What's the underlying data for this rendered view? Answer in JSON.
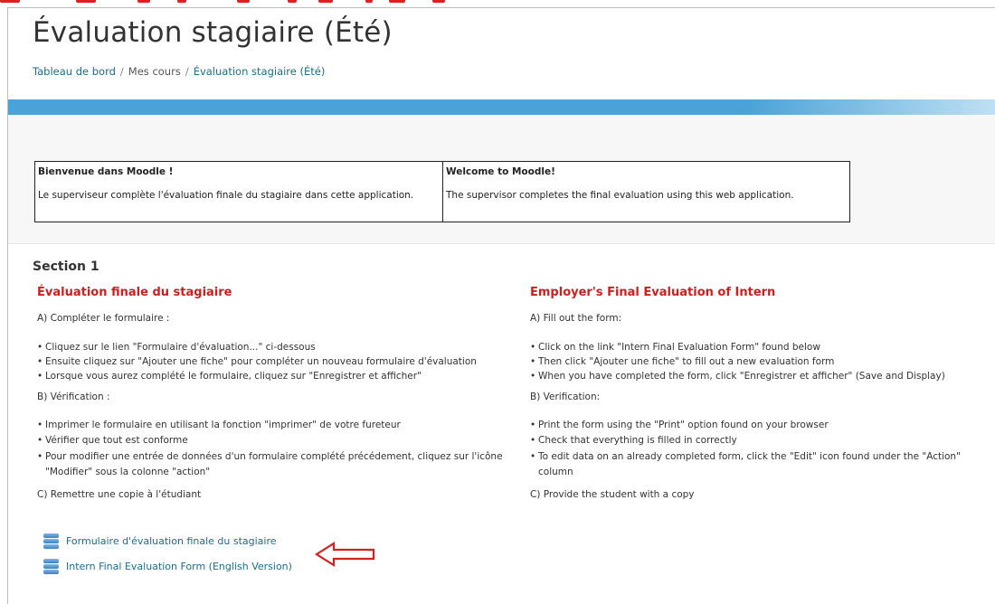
{
  "page": {
    "title": "Évaluation stagiaire (Été)"
  },
  "breadcrumb": {
    "items": [
      "Tableau de bord",
      "Mes cours",
      "Évaluation stagiaire (Été)"
    ],
    "separator": "/"
  },
  "welcome": {
    "fr_heading": "Bienvenue dans Moodle !",
    "fr_text": "Le superviseur complète l'évaluation finale du stagiaire dans cette application.",
    "en_heading": "Welcome to Moodle!",
    "en_text": "The supervisor completes the final evaluation using this web application."
  },
  "section": {
    "title": "Section 1",
    "fr": {
      "heading": "Évaluation finale du stagiaire",
      "a_label": "A) Compléter le formulaire :",
      "a_items": [
        "Cliquez sur le lien \"Formulaire d'évaluation...\" ci-dessous",
        "Ensuite cliquez sur \"Ajouter une fiche\" pour compléter un nouveau formulaire d'évaluation",
        "Lorsque vous aurez complété le formulaire, cliquez sur \"Enregistrer et afficher\""
      ],
      "b_label": "B) Vérification :",
      "b_items": [
        "Imprimer le formulaire en utilisant la fonction \"imprimer\" de votre fureteur",
        "Vérifier que tout est conforme",
        "Pour modifier une entrée de données d'un formulaire complété précédement, cliquez sur l'icône \"Modifier\" sous la colonne \"action\""
      ],
      "c_label": "C) Remettre une copie à l'étudiant"
    },
    "en": {
      "heading": "Employer's Final Evaluation of Intern",
      "a_label": "A) Fill out the form:",
      "a_items": [
        "Click on the link \"Intern Final Evaluation Form\" found below",
        "Then click \"Ajouter une fiche\" to fill out a new evaluation form",
        "When you have completed the form, click \"Enregistrer et afficher\" (Save and Display)"
      ],
      "b_label": "B) Verification:",
      "b_items": [
        "Print the form using the \"Print\" option found on your browser",
        "Check that everything is filled in correctly",
        "To edit data on an already completed form, click the \"Edit\" icon found under the \"Action\" column"
      ],
      "c_label": "C) Provide the student with a copy"
    }
  },
  "links": [
    {
      "label": "Formulaire d'évaluation finale du stagiaire",
      "icon": "database-icon"
    },
    {
      "label": "Intern Final Evaluation Form (English Version)",
      "icon": "database-icon"
    }
  ],
  "colors": {
    "accent_red": "#cc1f1f",
    "link_blue": "#1a6e8e",
    "band_blue": "#4aa3d8"
  }
}
